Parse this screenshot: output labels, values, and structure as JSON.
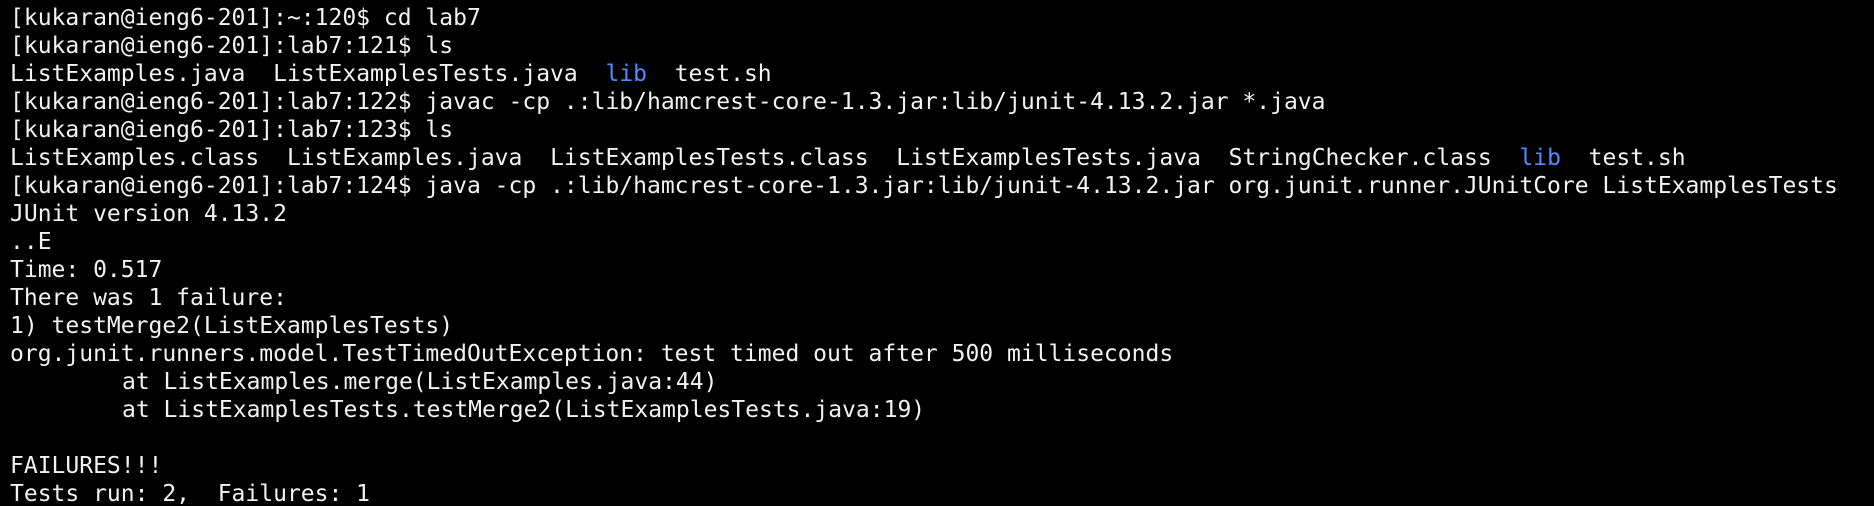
{
  "terminal": {
    "colors": {
      "background": "#000000",
      "foreground": "#f2f2f2",
      "directory": "#4f8cff"
    },
    "lines": [
      {
        "prompt": "[kukaran@ieng6-201]:~:120$",
        "command": " cd lab7"
      },
      {
        "prompt": "[kukaran@ieng6-201]:lab7:121$",
        "command": " ls"
      },
      {
        "ls": [
          "ListExamples.java",
          "ListExamplesTests.java",
          "lib",
          "test.sh"
        ]
      },
      {
        "prompt": "[kukaran@ieng6-201]:lab7:122$",
        "command": " javac -cp .:lib/hamcrest-core-1.3.jar:lib/junit-4.13.2.jar *.java"
      },
      {
        "prompt": "[kukaran@ieng6-201]:lab7:123$",
        "command": " ls"
      },
      {
        "ls": [
          "ListExamples.class",
          "ListExamples.java",
          "ListExamplesTests.class",
          "ListExamplesTests.java",
          "StringChecker.class",
          "lib",
          "test.sh"
        ]
      },
      {
        "prompt": "[kukaran@ieng6-201]:lab7:124$",
        "command": " java -cp .:lib/hamcrest-core-1.3.jar:lib/junit-4.13.2.jar org.junit.runner.JUnitCore ListExamplesTests"
      }
    ],
    "output": {
      "junit_version": "JUnit version 4.13.2",
      "progress": "..E",
      "time": "Time: 0.517",
      "failure_count": "There was 1 failure:",
      "failure_title": "1) testMerge2(ListExamplesTests)",
      "exception": "org.junit.runners.model.TestTimedOutException: test timed out after 500 milliseconds",
      "stack": [
        "at ListExamples.merge(ListExamples.java:44)",
        "at ListExamplesTests.testMerge2(ListExamplesTests.java:19)"
      ],
      "failures_banner": "FAILURES!!!",
      "summary": "Tests run: 2,  Failures: 1"
    }
  }
}
